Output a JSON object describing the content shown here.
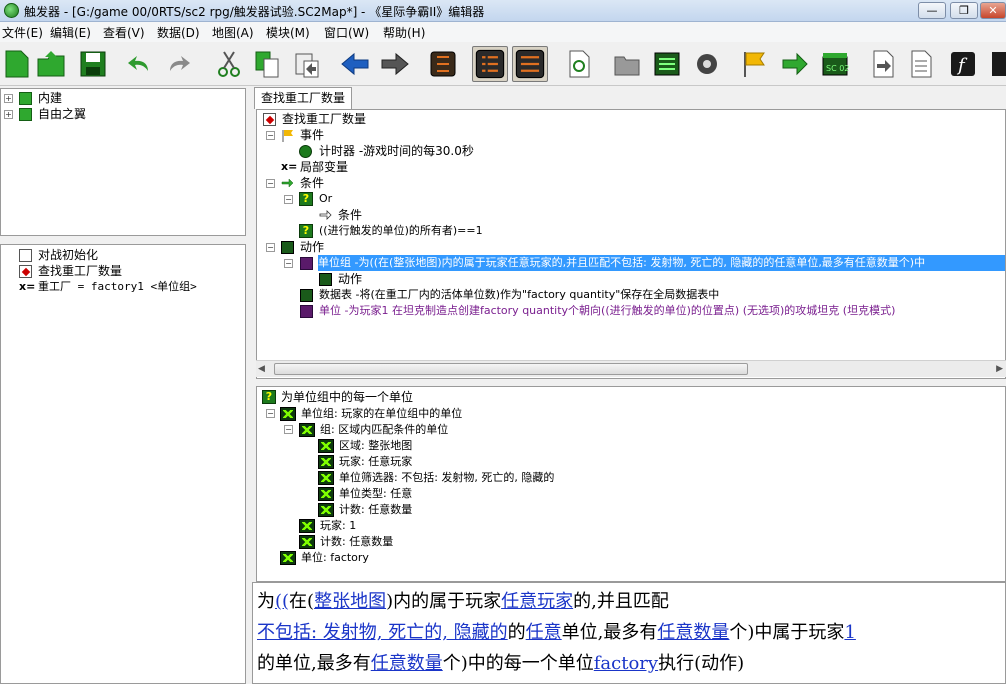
{
  "window": {
    "title": "触发器 - [G:/game 00/0RTS/sc2  rpg/触发器试验.SC2Map*] - 《星际争霸II》编辑器",
    "min": "—",
    "max": "❐",
    "close": "✕"
  },
  "menu": [
    "文件(E)",
    "编辑(E)",
    "查看(V)",
    "数据(D)",
    "地图(A)",
    "模块(M)",
    "窗口(W)",
    "帮助(H)"
  ],
  "left_top": {
    "items": [
      "内建",
      "自由之翼"
    ]
  },
  "left_bottom": {
    "items": [
      "对战初始化",
      "查找重工厂数量",
      "重工厂 = factory1 <单位组>"
    ]
  },
  "tab": {
    "label": "查找重工厂数量"
  },
  "main_tree": {
    "root": "查找重工厂数量",
    "events": "事件",
    "timer": "计时器 -游戏时间的每30.0秒",
    "locals": "局部变量",
    "conditions": "条件",
    "or": "Or",
    "cond_sub": "条件",
    "cond_expr": "((进行触发的单位)的所有者)==1",
    "actions": "动作",
    "action1": "单位组 -为((在(整张地图)内的属于玩家任意玩家的,并且匹配不包括: 发射物, 死亡的, 隐藏的的任意单位,最多有任意数量个)中",
    "action1_sub": "动作",
    "action2": "数据表 -将(在重工厂内的活体单位数)作为\"factory  quantity\"保存在全局数据表中",
    "action3": "单位 -为玩家1 在坦克制造点创建factory quantity个朝向((进行触发的单位)的位置点) (无选项)的攻城坦克 (坦克模式)"
  },
  "detail_tree": {
    "root": "为单位组中的每一个单位",
    "n1": "单位组: 玩家的在单位组中的单位",
    "n2": "组: 区域内匹配条件的单位",
    "n3": "区域: 整张地图",
    "n4": "玩家: 任意玩家",
    "n5": "单位筛选器: 不包括: 发射物, 死亡的, 隐藏的",
    "n6": "单位类型: 任意",
    "n7": "计数: 任意数量",
    "n8": "玩家: 1",
    "n9": "计数: 任意数量",
    "n10": "单位: factory"
  },
  "sentence": {
    "p1": "为",
    "l1": "((",
    "p2": "在(",
    "l2": "整张地图",
    "p3": ")内的属于玩家",
    "l3": "任意玩家",
    "p4": "的,并且匹配",
    "l4": "不包括: 发射物, 死亡的, 隐藏的",
    "p5": "的",
    "l5": "任意",
    "p6": "单位,最多有",
    "l6": "任意数量",
    "p7": "个)中属于玩家",
    "l7": "1",
    "p8": "的单位,最多有",
    "l8": "任意数量",
    "p9": "个)中的每一个单位",
    "l9": "factory",
    "p10": "执行(动作)"
  },
  "colors": {
    "highlight": "#3399ff",
    "link": "#1a35c8",
    "action_text": "#7a1f8f"
  }
}
